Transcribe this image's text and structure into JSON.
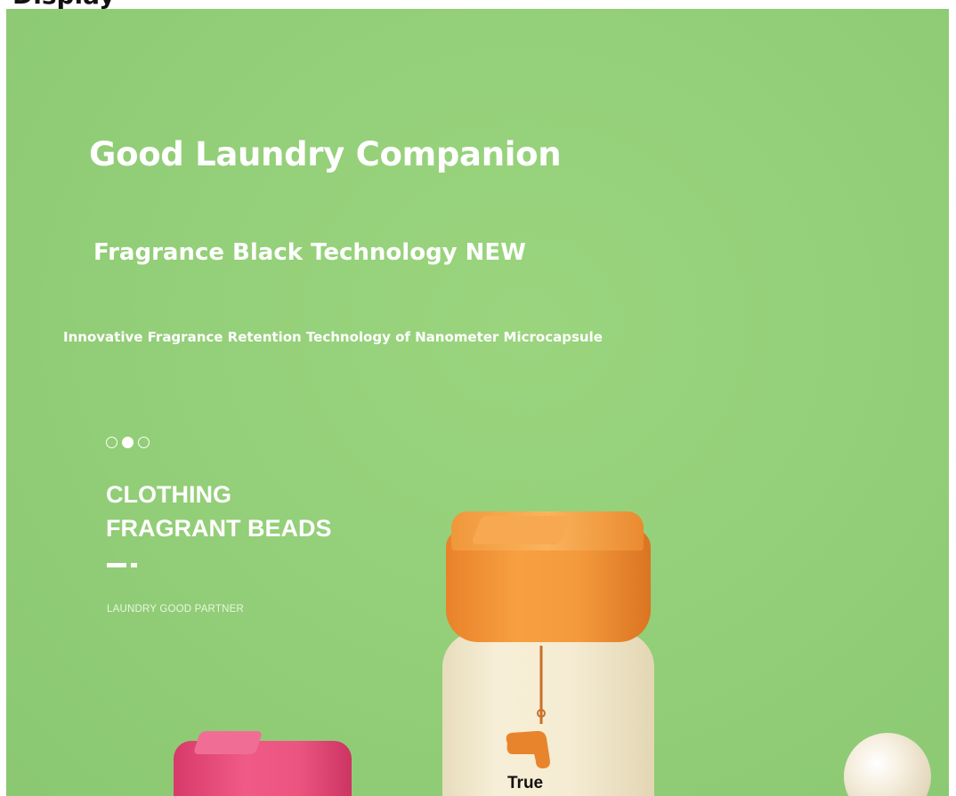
{
  "clipped_top_text": "Display",
  "banner": {
    "headline": "Good Laundry Companion",
    "subheadline": "Fragrance Black Technology NEW",
    "tagline": "Innovative Fragrance Retention Technology of Nanometer Microcapsule"
  },
  "carousel": {
    "dots": 3,
    "active_index": 1
  },
  "product": {
    "line1": "CLOTHING",
    "line2": "FRAGRANT BEADS",
    "partner": "LAUNDRY GOOD PARTNER",
    "bottle_label": "True"
  },
  "colors": {
    "background": "#94cf79",
    "cap_orange": "#f39a3c",
    "cap_pink": "#ec5480",
    "bottle_cream": "#f5ecd3"
  },
  "icons": [
    "hair-dryer-icon"
  ]
}
